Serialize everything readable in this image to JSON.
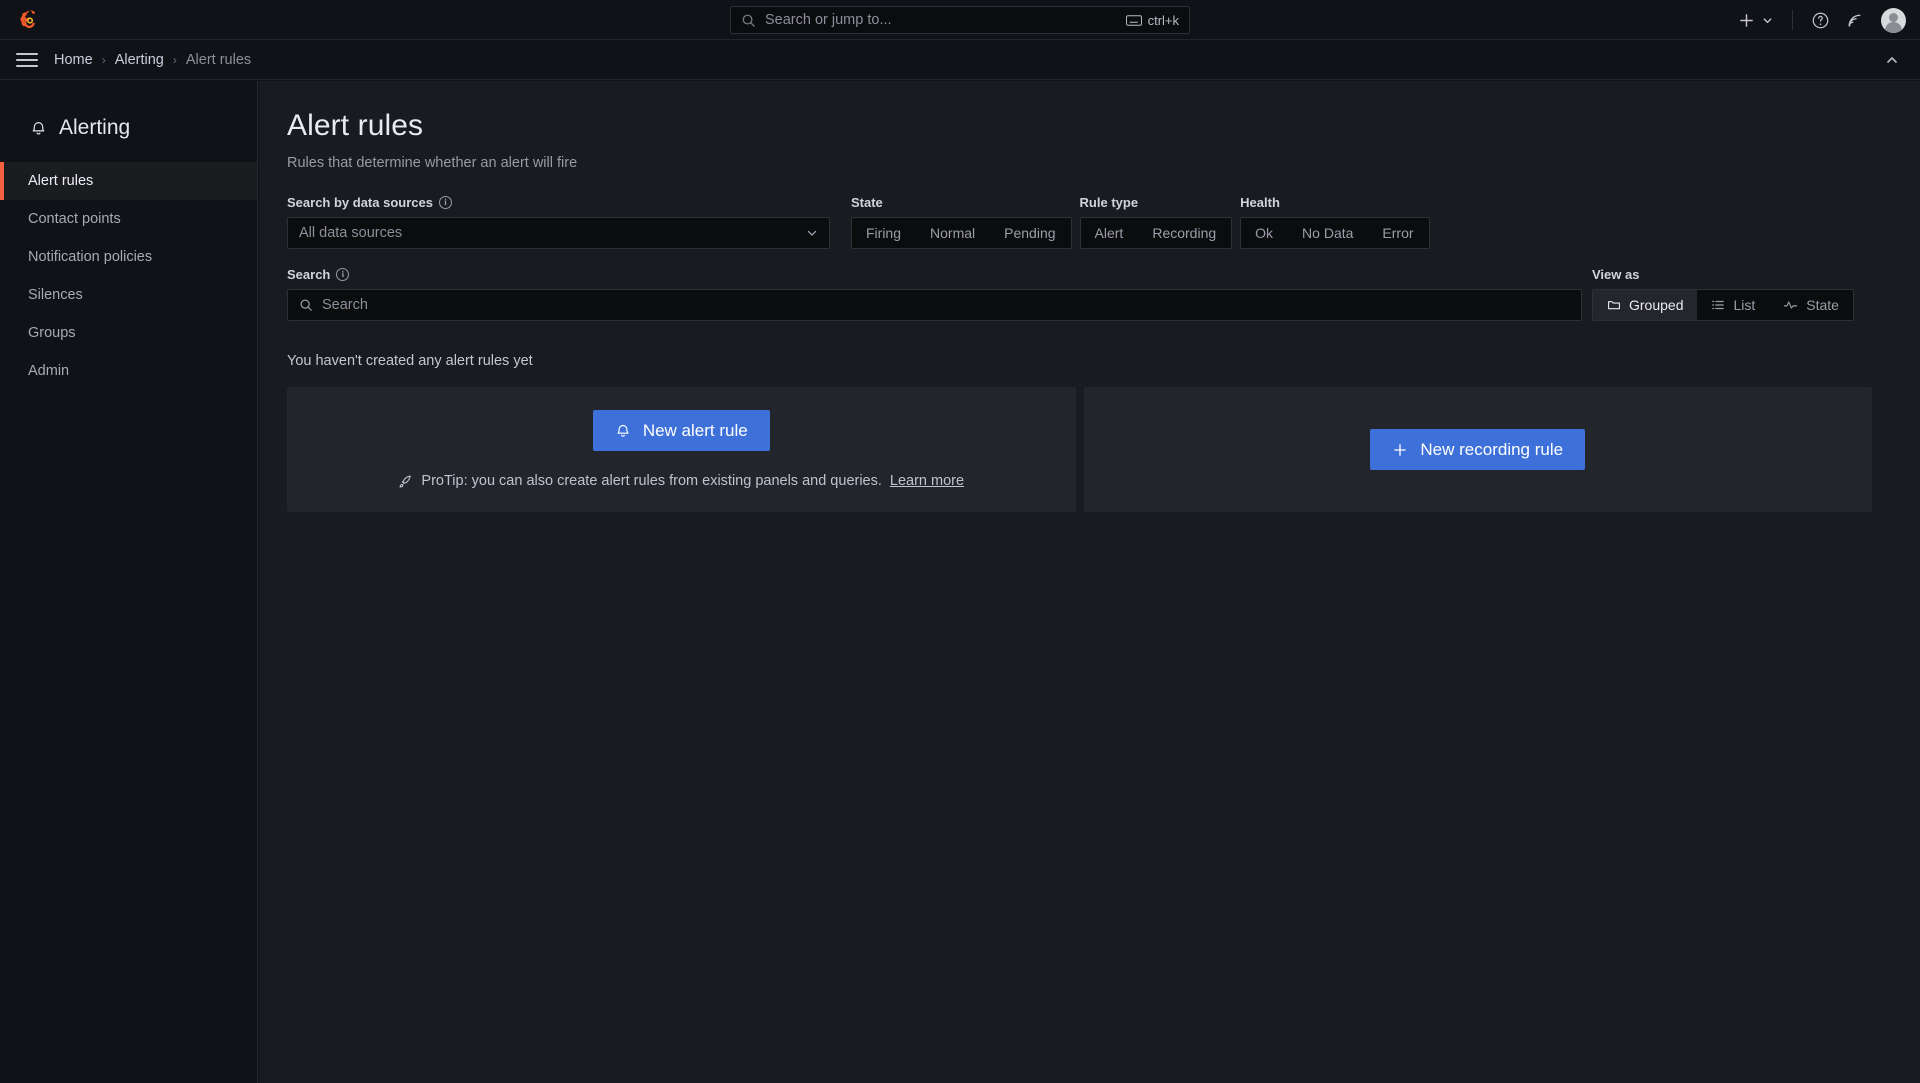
{
  "topbar": {
    "logo_icon": "grafana-logo-icon",
    "search": {
      "placeholder": "Search or jump to...",
      "shortcut": "ctrl+k",
      "search_icon": "search-icon",
      "keyboard_icon": "keyboard-icon"
    },
    "actions": {
      "add_icon": "plus-icon",
      "add_chevron_icon": "chevron-down-icon",
      "help_icon": "help-circle-icon",
      "news_icon": "rss-feed-icon",
      "avatar_icon": "user-avatar-icon"
    }
  },
  "breadcrumb": {
    "menu_icon": "hamburger-menu-icon",
    "items": [
      {
        "label": "Home",
        "current": false
      },
      {
        "label": "Alerting",
        "current": false
      },
      {
        "label": "Alert rules",
        "current": true
      }
    ],
    "separator": "›",
    "collapse_icon": "chevron-up-icon"
  },
  "sidebar": {
    "title": "Alerting",
    "title_icon": "bell-icon",
    "active_accent": "#f55f3e",
    "items": [
      {
        "label": "Alert rules",
        "active": true
      },
      {
        "label": "Contact points",
        "active": false
      },
      {
        "label": "Notification policies",
        "active": false
      },
      {
        "label": "Silences",
        "active": false
      },
      {
        "label": "Groups",
        "active": false
      },
      {
        "label": "Admin",
        "active": false
      }
    ]
  },
  "main": {
    "title": "Alert rules",
    "subtitle": "Rules that determine whether an alert will fire",
    "filters": {
      "datasource": {
        "label": "Search by data sources",
        "info_icon": "info-circle-icon",
        "value": "All data sources",
        "chevron_icon": "chevron-down-icon"
      },
      "state": {
        "label": "State",
        "options": [
          "Firing",
          "Normal",
          "Pending"
        ],
        "selected": null
      },
      "rule_type": {
        "label": "Rule type",
        "options": [
          "Alert",
          "Recording"
        ],
        "selected": null
      },
      "health": {
        "label": "Health",
        "options": [
          "Ok",
          "No Data",
          "Error"
        ],
        "selected": null
      }
    },
    "search": {
      "label": "Search",
      "info_icon": "info-circle-icon",
      "search_icon": "search-icon",
      "placeholder": "Search",
      "value": ""
    },
    "view_as": {
      "label": "View as",
      "options": [
        {
          "label": "Grouped",
          "icon": "folder-icon",
          "selected": true
        },
        {
          "label": "List",
          "icon": "list-icon",
          "selected": false
        },
        {
          "label": "State",
          "icon": "pulse-icon",
          "selected": false
        }
      ]
    },
    "empty_state": {
      "message": "You haven't created any alert rules yet",
      "cards": [
        {
          "button_label": "New alert rule",
          "button_icon": "bell-icon",
          "tip_icon": "rocket-icon",
          "tip_text": "ProTip: you can also create alert rules from existing panels and queries.",
          "tip_link": "Learn more"
        },
        {
          "button_label": "New recording rule",
          "button_icon": "plus-icon"
        }
      ]
    }
  },
  "colors": {
    "primary_button": "#3d71d9",
    "accent": "#f55f3e",
    "page_bg": "#111217",
    "content_bg": "#181b1f",
    "card_bg": "#22252b"
  }
}
